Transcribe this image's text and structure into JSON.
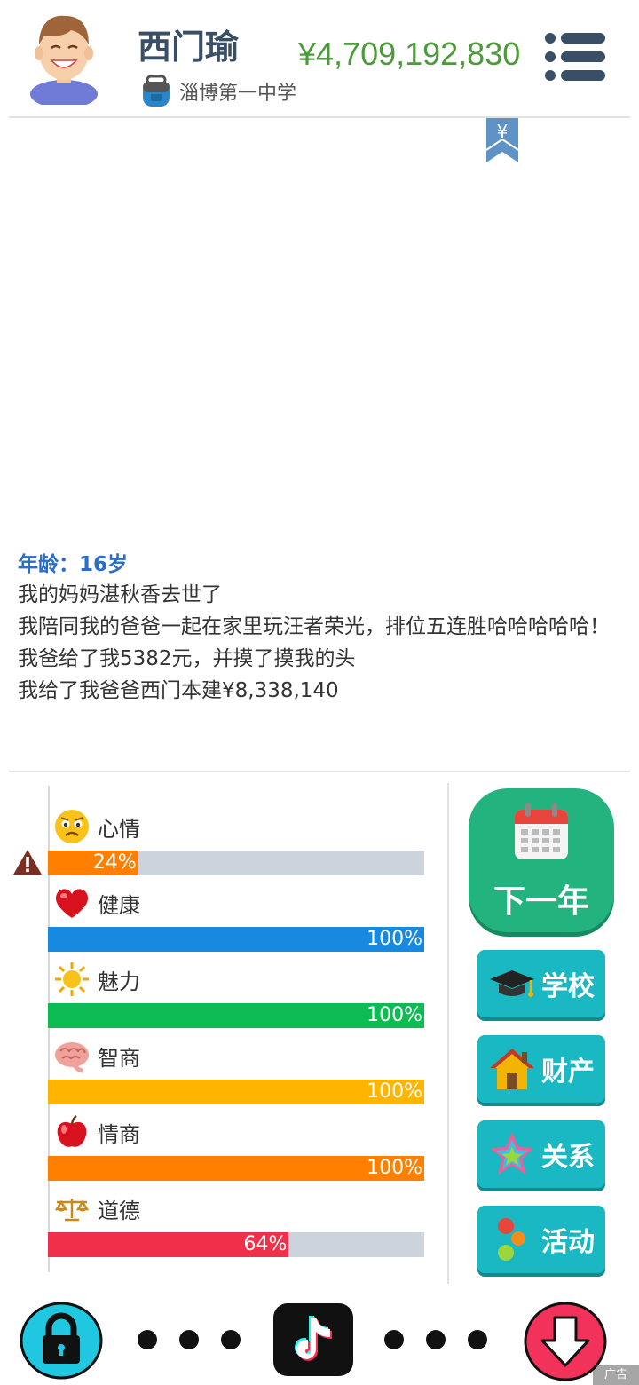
{
  "player": {
    "name": "西门瑜",
    "school": "淄博第一中学",
    "money": "¥4,709,192,830"
  },
  "story": {
    "age_line": "年龄：16岁",
    "events": [
      "我的妈妈湛秋香去世了",
      "我陪同我的爸爸一起在家里玩汪者荣光，排位五连胜哈哈哈哈哈！",
      "我爸给了我5382元，并摸了摸我的头",
      "我给了我爸爸西门本建¥8,338,140"
    ]
  },
  "stats": [
    {
      "label": "心情",
      "value": 24,
      "pct_text": "24%",
      "color": "#ff8000",
      "icon": "sad-face-icon",
      "warning": true
    },
    {
      "label": "健康",
      "value": 100,
      "pct_text": "100%",
      "color": "#1789e0",
      "icon": "heart-icon",
      "warning": false
    },
    {
      "label": "魅力",
      "value": 100,
      "pct_text": "100%",
      "color": "#0cbc52",
      "icon": "sun-icon",
      "warning": false
    },
    {
      "label": "智商",
      "value": 100,
      "pct_text": "100%",
      "color": "#ffb400",
      "icon": "brain-icon",
      "warning": false
    },
    {
      "label": "情商",
      "value": 100,
      "pct_text": "100%",
      "color": "#ff8000",
      "icon": "apple-icon",
      "warning": false
    },
    {
      "label": "道德",
      "value": 64,
      "pct_text": "64%",
      "color": "#f0304a",
      "icon": "scales-icon",
      "warning": false
    }
  ],
  "buttons": {
    "next_year": "下一年",
    "school": "学校",
    "assets": "财产",
    "relations": "关系",
    "activities": "活动"
  },
  "ribbon_symbol": "¥",
  "ad_label": "广告",
  "colors": {
    "money": "#4c9a3a",
    "age": "#2a6dc7",
    "next_year_bg": "#23b37f",
    "side_btn_bg": "#1ab8c2"
  }
}
